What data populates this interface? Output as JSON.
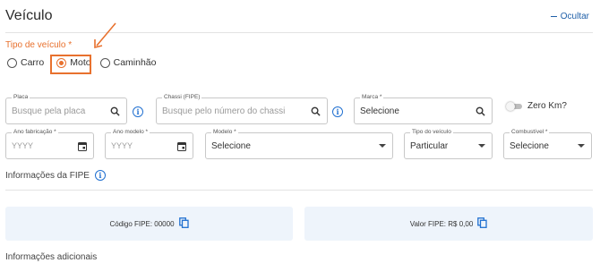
{
  "header": {
    "title": "Veículo",
    "hide_label": "Ocultar"
  },
  "vehicle_type": {
    "label": "Tipo de veículo *",
    "options": [
      {
        "label": "Carro",
        "selected": false
      },
      {
        "label": "Moto",
        "selected": true
      },
      {
        "label": "Caminhão",
        "selected": false
      }
    ]
  },
  "row1": {
    "plate": {
      "label": "Placa",
      "placeholder": "Busque pela placa"
    },
    "chassis": {
      "label": "Chassi (FIPE)",
      "placeholder": "Busque pelo número do chassi"
    },
    "brand": {
      "label": "Marca *",
      "value": "Selecione"
    },
    "zero_km": {
      "label": "Zero Km?",
      "on": false
    }
  },
  "row2": {
    "manufacture_year": {
      "label": "Ano fabricação *",
      "placeholder": "YYYY"
    },
    "model_year": {
      "label": "Ano modelo *",
      "placeholder": "YYYY"
    },
    "model": {
      "label": "Modelo *",
      "value": "Selecione"
    },
    "vehicle_kind": {
      "label": "Tipo do veículo",
      "value": "Particular"
    },
    "fuel": {
      "label": "Combustível *",
      "value": "Selecione"
    }
  },
  "fipe": {
    "section_title": "Informações da FIPE",
    "code_text": "Código FIPE: 00000",
    "value_text": "Valor FIPE: R$ 0,00"
  },
  "additional": {
    "section_title": "Informações adicionais"
  },
  "colors": {
    "accent": "#e8712e",
    "link": "#1f5fa8",
    "info": "#1f6fd0",
    "card_bg": "#eef4fb"
  }
}
